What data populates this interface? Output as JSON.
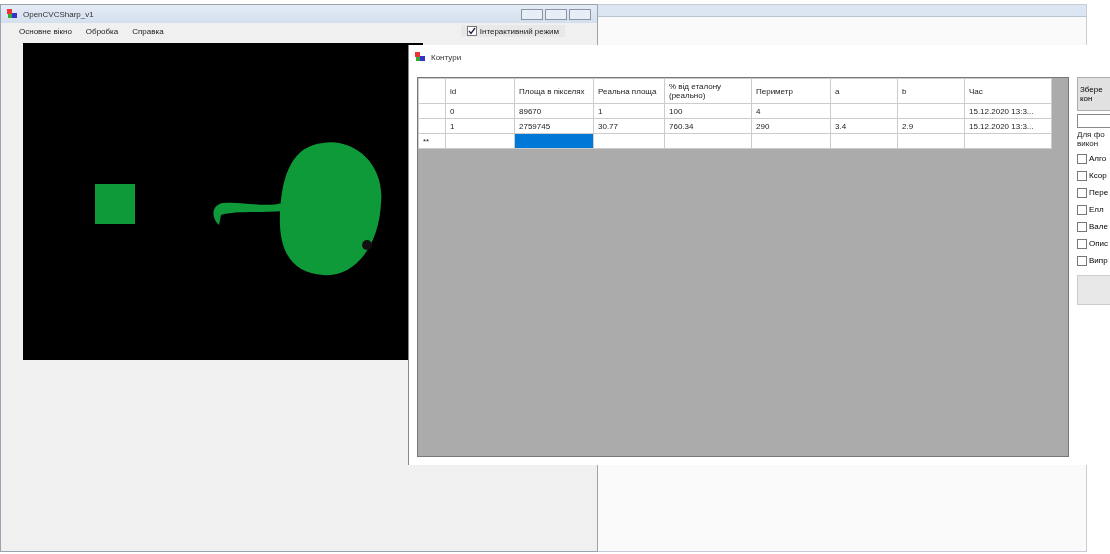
{
  "main_window": {
    "title": "OpenCVCSharp_v1",
    "menu": [
      "Основне вікно",
      "Обробка",
      "Справка"
    ],
    "interactive_mode": {
      "label": "Інтерактивний режим",
      "checked": true
    }
  },
  "contours_window": {
    "title": "Контури",
    "table": {
      "columns": [
        "id",
        "Площа в пікселях",
        "Реальна площа",
        "% від еталону (реально)",
        "Периметр",
        "a",
        "b",
        "Час"
      ],
      "rows": [
        {
          "cells": [
            {
              "text": "0",
              "selected": false
            },
            {
              "text": "89670",
              "selected": false
            },
            {
              "text": "1",
              "selected": false
            },
            {
              "text": "100",
              "selected": false
            },
            {
              "text": "4",
              "selected": false
            },
            {
              "selected": false
            },
            {
              "selected": false
            },
            {
              "text": "15.12.2020 13:3...",
              "selected": false
            }
          ]
        },
        {
          "cells": [
            {
              "text": "1",
              "selected": false
            },
            {
              "text": "2759745",
              "selected": false
            },
            {
              "text": "30.77",
              "selected": false
            },
            {
              "text": "760.34",
              "selected": false
            },
            {
              "text": "290",
              "selected": false
            },
            {
              "text": "3.4",
              "selected": false
            },
            {
              "text": "2.9",
              "selected": false
            },
            {
              "text": "15.12.2020 13:3...",
              "selected": false
            }
          ]
        },
        {
          "marker": "**",
          "cells": [
            {
              "selected": false
            },
            {
              "selected": true
            },
            {
              "selected": false
            },
            {
              "selected": false
            },
            {
              "selected": false
            },
            {
              "selected": false
            },
            {
              "selected": false
            },
            {
              "selected": false
            }
          ]
        }
      ]
    },
    "side_panel": {
      "button": "Збере\nкон",
      "note": "Для фо\nвикон",
      "options": [
        {
          "label": "Алго",
          "checked": false
        },
        {
          "label": "Ксор",
          "checked": false
        },
        {
          "label": "Пере",
          "checked": false
        },
        {
          "label": "Елл",
          "checked": false
        },
        {
          "label": "Вале",
          "checked": false
        },
        {
          "label": "Опис",
          "checked": false
        },
        {
          "label": "Випр",
          "checked": false
        }
      ]
    }
  }
}
